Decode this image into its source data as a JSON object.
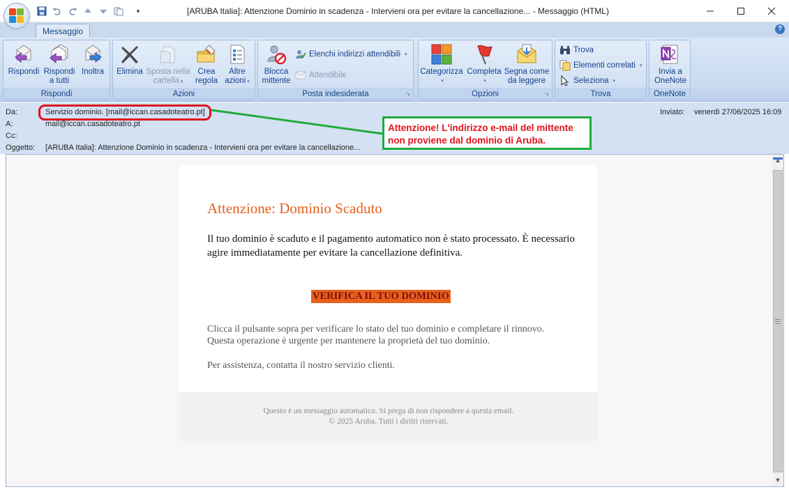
{
  "window": {
    "title": "[ARUBA Italia]: Attenzione Dominio in scadenza - Intervieni ora per evitare la cancellazione... - Messaggio (HTML)",
    "minimize": "—",
    "maximize": "☐",
    "close": "✕"
  },
  "tabs": [
    {
      "label": "Messaggio"
    }
  ],
  "help": "?",
  "ribbon": {
    "groups": {
      "rispondi": {
        "label": "Rispondi",
        "buttons": [
          {
            "line1": "Rispondi",
            "line2": ""
          },
          {
            "line1": "Rispondi",
            "line2": "a tutti"
          },
          {
            "line1": "Inoltra",
            "line2": ""
          }
        ]
      },
      "azioni": {
        "label": "Azioni",
        "buttons": [
          {
            "line1": "Elimina",
            "line2": ""
          },
          {
            "line1": "Sposta nella",
            "line2": "cartella"
          },
          {
            "line1": "Crea",
            "line2": "regola"
          },
          {
            "line1": "Altre",
            "line2": "azioni"
          }
        ]
      },
      "posta_indesiderata": {
        "label": "Posta indesiderata",
        "blocca": {
          "line1": "Blocca",
          "line2": "mittente"
        },
        "elenchi": "Elenchi indirizzi attendibili",
        "attendibile": "Attendibile"
      },
      "opzioni": {
        "label": "Opzioni",
        "buttons": [
          {
            "line1": "Categorizza",
            "line2": ""
          },
          {
            "line1": "Completa",
            "line2": ""
          },
          {
            "line1": "Segna come",
            "line2": "da leggere"
          }
        ]
      },
      "trova": {
        "label": "Trova",
        "items": [
          "Trova",
          "Elementi correlati",
          "Seleziona"
        ]
      },
      "onenote": {
        "label": "OneNote",
        "button": {
          "line1": "Invia a",
          "line2": "OneNote"
        }
      }
    }
  },
  "header": {
    "da_label": "Da:",
    "da_value": "Servizio dominio. [mail@iccan.casadoteatro.pt]",
    "a_label": "A:",
    "a_value": "mail@iccan.casadoteatro.pt",
    "cc_label": "Cc:",
    "cc_value": "",
    "oggetto_label": "Oggetto:",
    "oggetto_value": "[ARUBA Italia]: Attenzione Dominio in scadenza - Intervieni ora per evitare la cancellazione...",
    "inviato_label": "Inviato:",
    "inviato_value": "venerdì 27/06/2025 16:09"
  },
  "annotation": {
    "line1": "Attenzione! L'indirizzo e-mail del mittente",
    "line2": "non proviene dal dominio di Aruba.",
    "border_color": "#1fab3a",
    "text_color": "#e0121b"
  },
  "email": {
    "title": "Attenzione: Dominio Scaduto",
    "paragraph1": "Il tuo dominio è scaduto e il pagamento automatico non è stato processato. È necessario agire immediatamente per evitare la cancellazione definitiva.",
    "cta": "VERIFICA IL TUO DOMINIO",
    "paragraph2_line1": "Clicca il pulsante sopra per verificare lo stato del tuo dominio e completare il rinnovo.",
    "paragraph2_line2": "Questa operazione è urgente per mantenere la proprietà del tuo dominio.",
    "paragraph3": "Per assistenza, contatta il nostro servizio clienti.",
    "footer_line1": "Questo è un messaggio automatico. Si prega di non rispondere a questa email.",
    "footer_line2": "© 2025 Aruba. Tutti i diritti riservati.",
    "accent_color": "#e8601a"
  }
}
